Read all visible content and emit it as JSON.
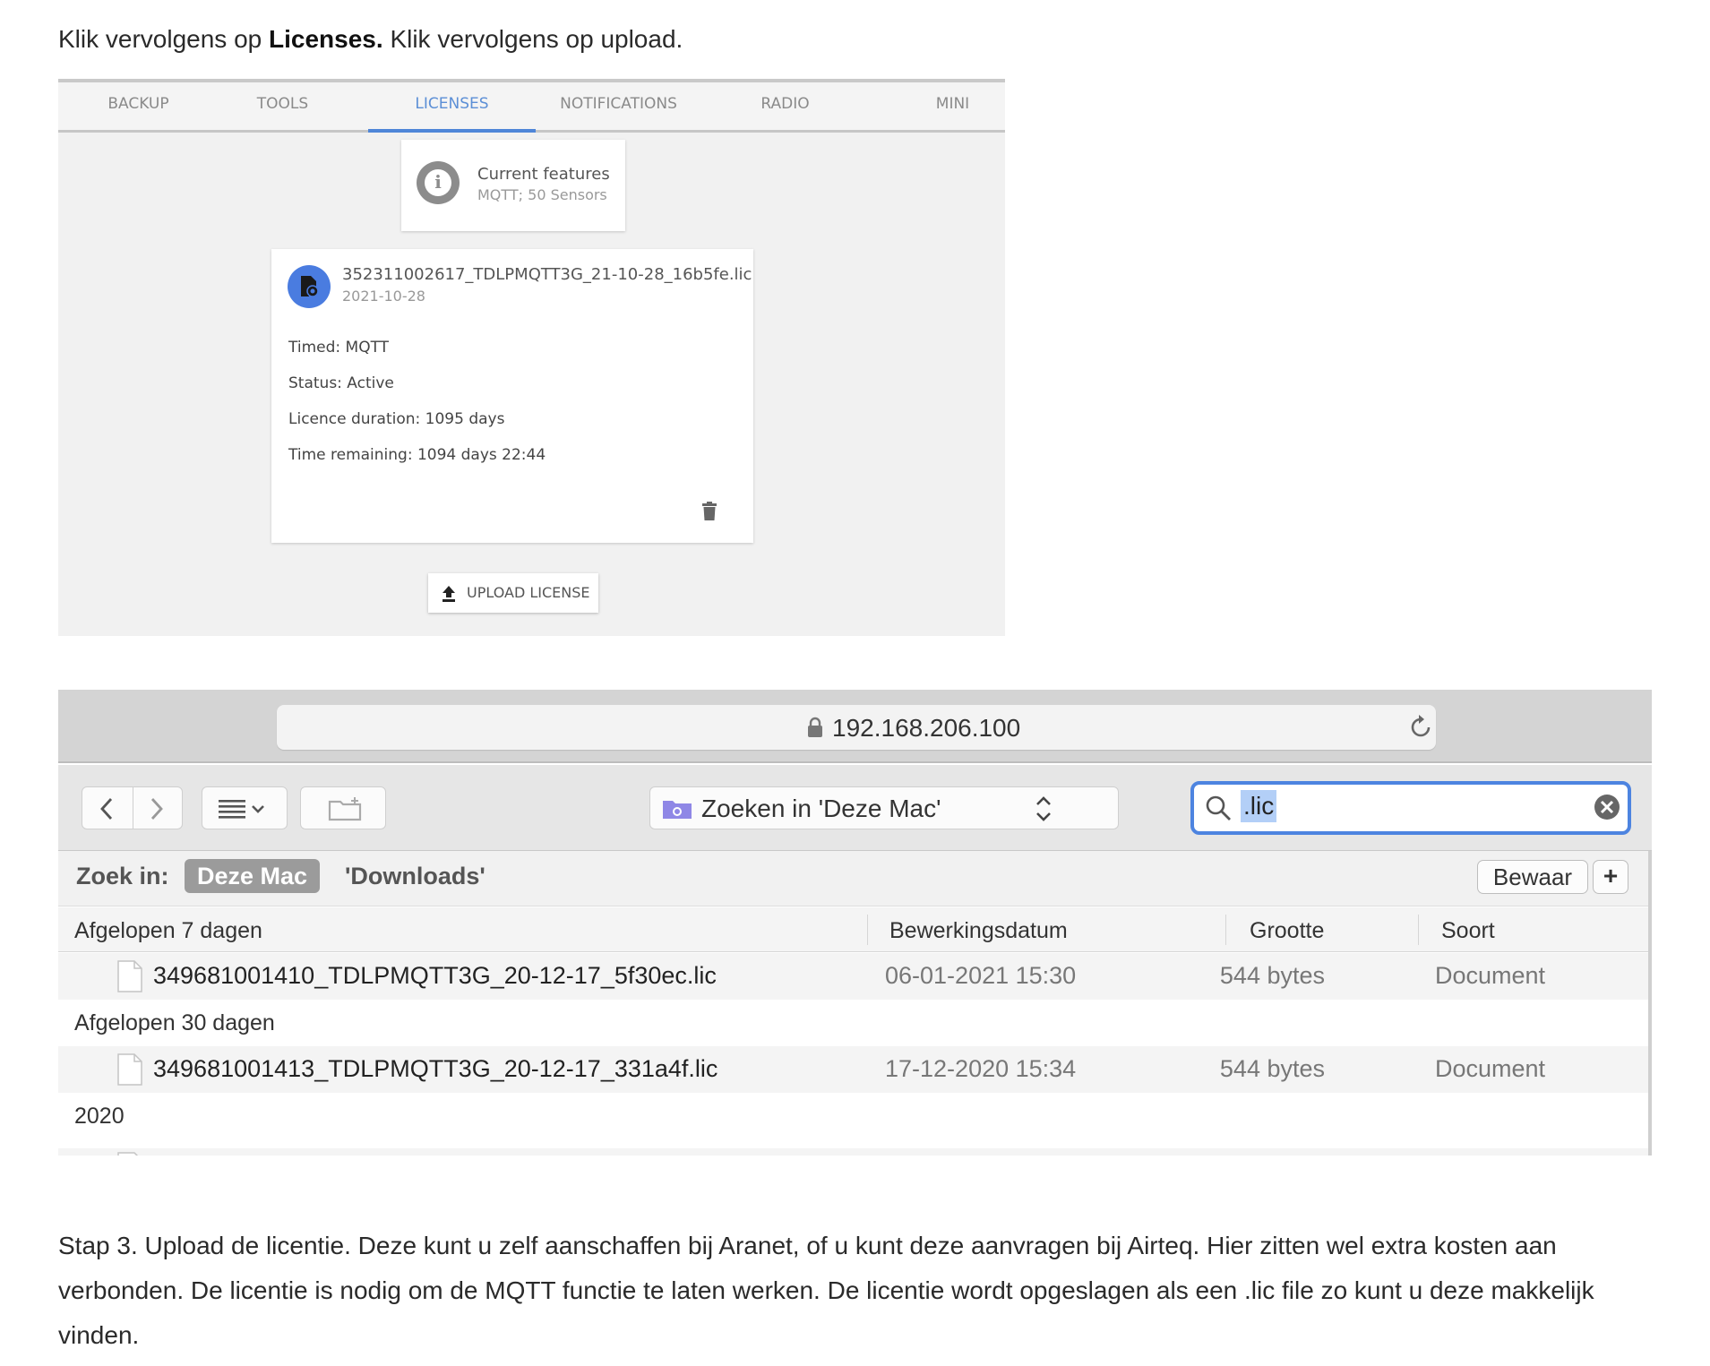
{
  "intro": {
    "prefix": "Klik vervolgens op",
    "bold": "Licenses.",
    "suffix": "Klik vervolgens op upload."
  },
  "aranet": {
    "tabs": [
      "BACKUP",
      "TOOLS",
      "LICENSES",
      "NOTIFICATIONS",
      "RADIO",
      "MINI"
    ],
    "active_tab": "LICENSES",
    "features": {
      "title": "Current features",
      "subtitle": "MQTT; 50 Sensors"
    },
    "license": {
      "file": "352311002617_TDLPMQTT3G_21-10-28_16b5fe.lic",
      "date": "2021-10-28",
      "timed": "Timed: MQTT",
      "status": "Status: Active",
      "duration": "Licence duration: 1095 days",
      "remaining": "Time remaining: 1094 days 22:44"
    },
    "upload_label": "UPLOAD LICENSE"
  },
  "finder": {
    "url": "192.168.206.100",
    "location_label": "Zoeken in 'Deze Mac'",
    "search_value": ".lic",
    "scope": {
      "label": "Zoek in:",
      "active": "Deze Mac",
      "other": "'Downloads'"
    },
    "save_label": "Bewaar",
    "add_label": "+",
    "columns": {
      "name": "Afgelopen 7 dagen",
      "date": "Bewerkingsdatum",
      "size": "Grootte",
      "kind": "Soort"
    },
    "group2": "Afgelopen 30 dagen",
    "group3": "2020",
    "rows": [
      {
        "name": "349681001410_TDLPMQTT3G_20-12-17_5f30ec.lic",
        "date": "06-01-2021 15:30",
        "size": "544 bytes",
        "kind": "Document"
      },
      {
        "name": "349681001413_TDLPMQTT3G_20-12-17_331a4f.lic",
        "date": "17-12-2020 15:34",
        "size": "544 bytes",
        "kind": "Document"
      }
    ]
  },
  "paragraph": "Stap 3. Upload de licentie. Deze kunt u zelf aanschaffen bij Aranet, of u kunt deze aanvragen bij Airteq. Hier zitten wel extra kosten aan verbonden. De licentie is nodig om de MQTT functie te laten werken. De licentie wordt opgeslagen als een .lic file zo kunt u deze makkelijk vinden."
}
